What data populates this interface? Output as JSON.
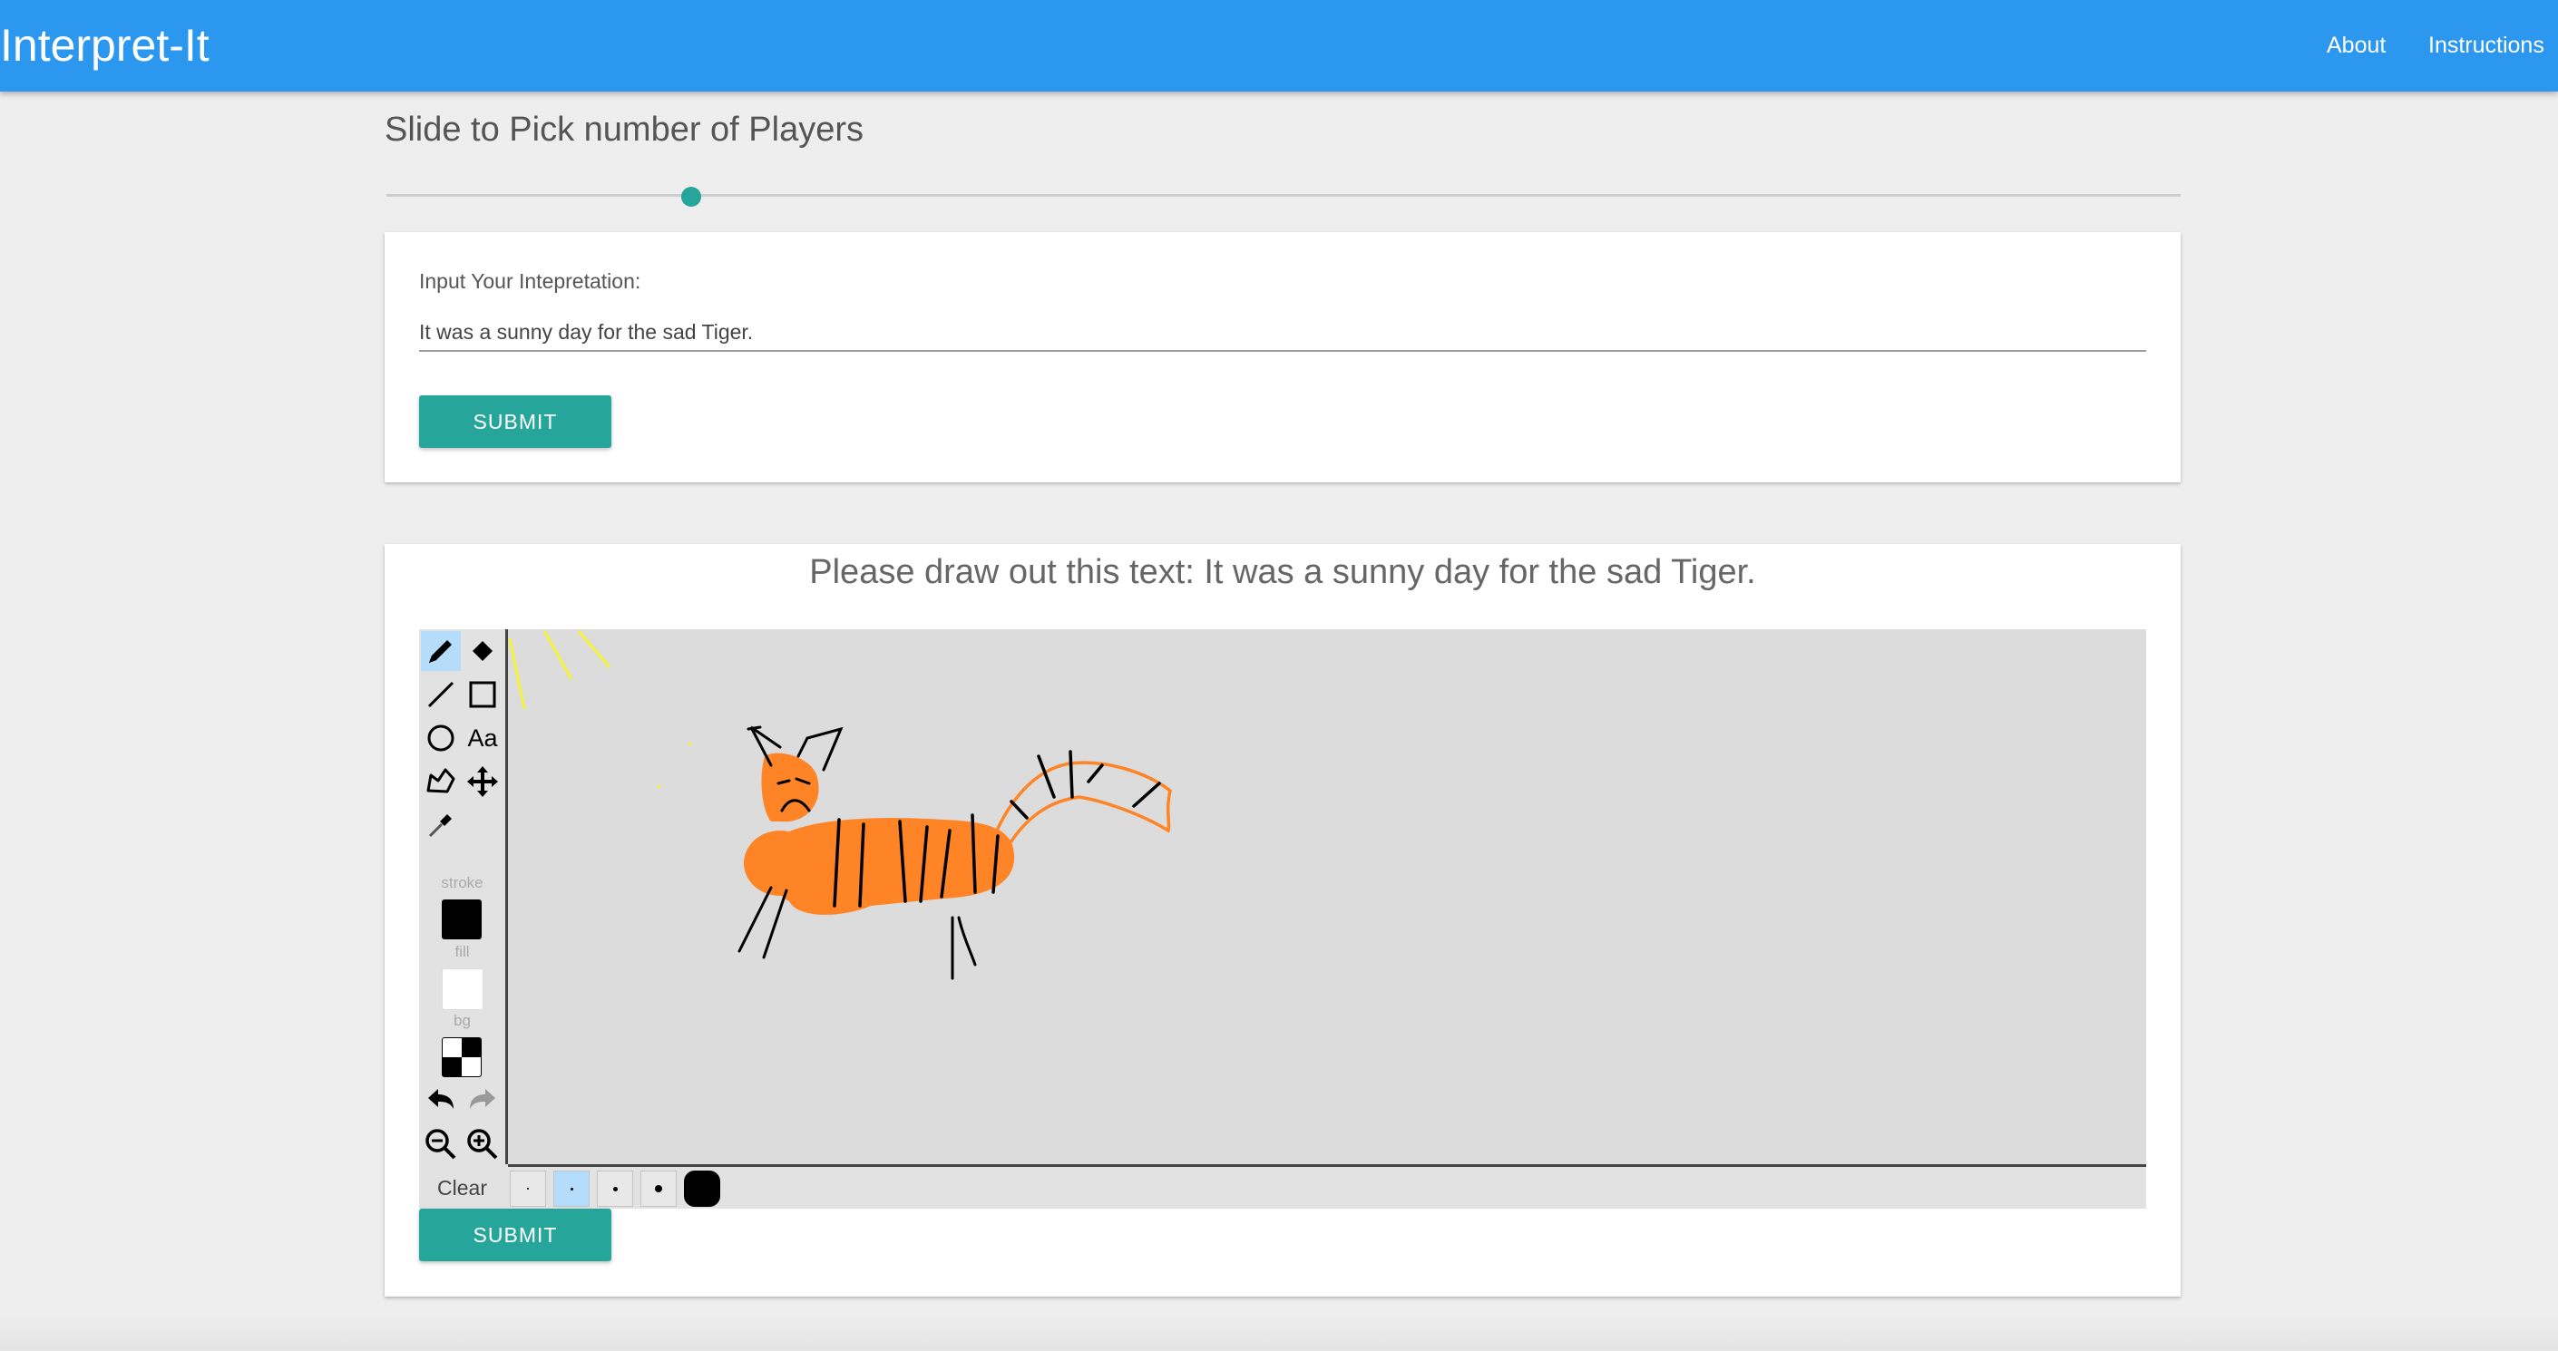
{
  "app": {
    "brand": "Interpret-It",
    "nav": {
      "about": "About",
      "instructions": "Instructions"
    },
    "header_color": "#2b97ef"
  },
  "players_slider": {
    "title": "Slide to Pick number of Players",
    "level_fraction": 0.17,
    "accent": "#26a69a"
  },
  "interpretation_card": {
    "label": "Input Your Intepretation:",
    "value": "It was a sunny day for the sad Tiger.",
    "submit_label": "SUBMIT"
  },
  "drawing_card": {
    "prompt": "Please draw out this text: It was a sunny day for the sad Tiger.",
    "submit_label": "SUBMIT",
    "tools": [
      {
        "icon": "pencil-icon",
        "active": true
      },
      {
        "icon": "eraser-icon",
        "active": false
      },
      {
        "icon": "line-icon",
        "active": false
      },
      {
        "icon": "rectangle-icon",
        "active": false
      },
      {
        "icon": "ellipse-icon",
        "active": false
      },
      {
        "icon": "text-tool-icon",
        "label": "Aa",
        "active": false
      },
      {
        "icon": "polygon-icon",
        "active": false
      },
      {
        "icon": "move-icon",
        "active": false
      },
      {
        "icon": "eyedropper-icon",
        "active": false
      }
    ],
    "swatches": {
      "stroke_label": "stroke",
      "stroke_color": "#000000",
      "fill_label": "fill",
      "fill_color": "#ffffff",
      "bg_label": "bg",
      "bg_pattern": "transparent-checker"
    },
    "history": {
      "undo_icon": "undo-icon",
      "redo_icon": "redo-icon"
    },
    "zoom": {
      "out_icon": "zoom-out-icon",
      "in_icon": "zoom-in-icon"
    },
    "clear_label": "Clear",
    "brush_sizes": [
      {
        "level": 1,
        "active": false
      },
      {
        "level": 2,
        "active": true
      },
      {
        "level": 3,
        "active": false
      },
      {
        "level": 4,
        "active": false
      },
      {
        "level": 5,
        "active": false
      }
    ],
    "drawing": {
      "subject": "orange tiger with black stripes and sad face, yellow sun rays",
      "tiger_color": "#ff8426",
      "stripe_color": "#000000",
      "sun_color": "#f5f23a",
      "canvas_bg": "#dcdcdc"
    }
  }
}
